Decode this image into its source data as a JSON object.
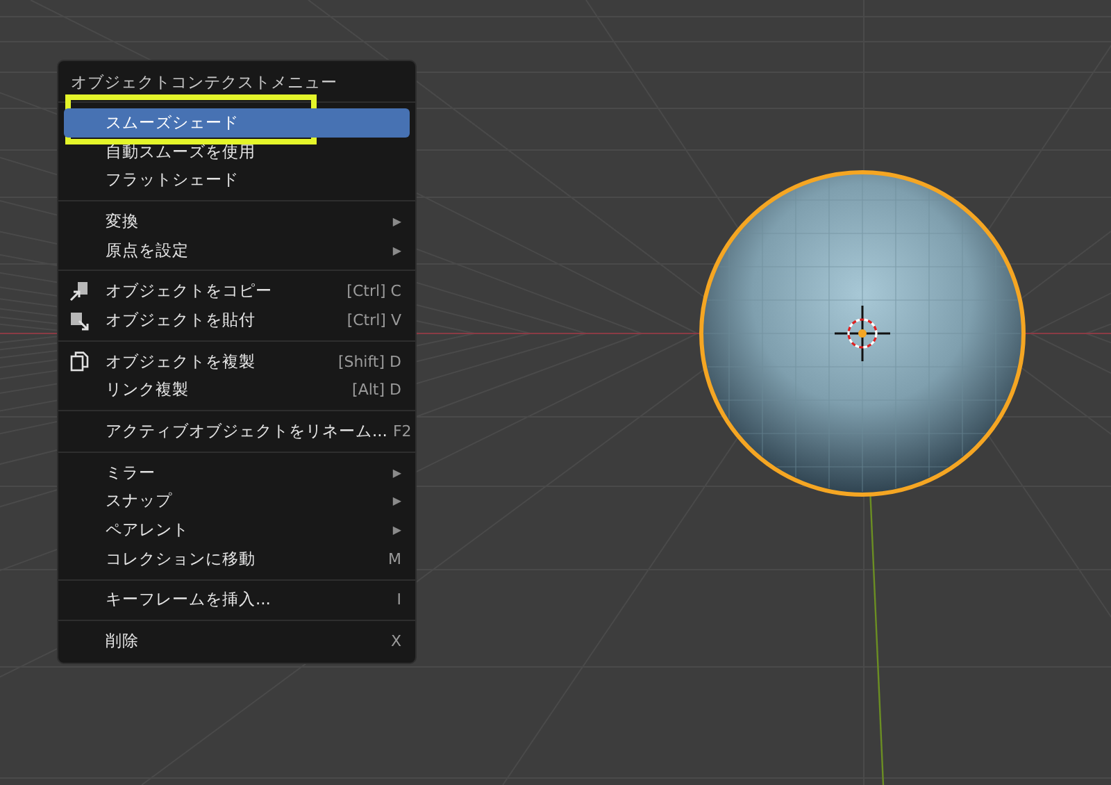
{
  "menu": {
    "title": "オブジェクトコンテクストメニュー",
    "groups": [
      [
        {
          "label": "スムーズシェード",
          "selected": true,
          "highlighted": true
        },
        {
          "label": "自動スムーズを使用",
          "selected": false
        },
        {
          "label": "フラットシェード",
          "selected": false
        }
      ],
      [
        {
          "label": "変換",
          "selected": false,
          "submenu": "▶"
        },
        {
          "label": "原点を設定",
          "selected": false,
          "submenu": "▶"
        }
      ],
      [
        {
          "label": "オブジェクトをコピー",
          "selected": false,
          "kind": "copy",
          "shortcut": "[Ctrl] C"
        },
        {
          "label": "オブジェクトを貼付",
          "selected": false,
          "kind": "paste",
          "shortcut": "[Ctrl] V"
        }
      ],
      [
        {
          "label": "オブジェクトを複製",
          "selected": false,
          "kind": "duplicate",
          "shortcut": "[Shift] D"
        },
        {
          "label": "リンク複製",
          "selected": false,
          "shortcut": "[Alt] D"
        }
      ],
      [
        {
          "label": "アクティブオブジェクトをリネーム...",
          "selected": false,
          "shortcut": "F2"
        }
      ],
      [
        {
          "label": "ミラー",
          "selected": false,
          "submenu": "▶"
        },
        {
          "label": "スナップ",
          "selected": false,
          "submenu": "▶"
        },
        {
          "label": "ペアレント",
          "selected": false,
          "submenu": "▶"
        },
        {
          "label": "コレクションに移動",
          "selected": false,
          "shortcut": "M"
        }
      ],
      [
        {
          "label": "キーフレームを挿入...",
          "selected": false,
          "shortcut": "I"
        }
      ],
      [
        {
          "label": "削除",
          "selected": false,
          "shortcut": "X"
        }
      ]
    ]
  }
}
